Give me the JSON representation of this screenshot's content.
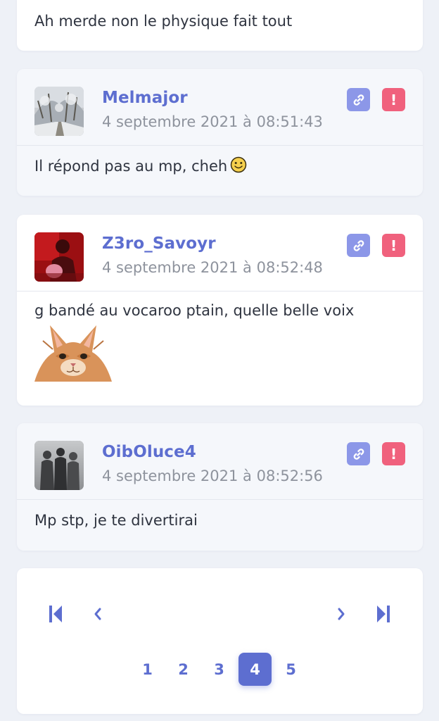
{
  "colors": {
    "accent": "#5d6ed0",
    "link_button": "#8c97e8",
    "report_button": "#f0617d",
    "date_text": "#8e939d"
  },
  "posts": [
    {
      "body": "Ah merde non le physique fait tout"
    },
    {
      "author": "Melmajor",
      "date": "4 septembre 2021 à 08:51:43",
      "body": "Il répond pas au mp, cheh",
      "emoji": "smiley-icon"
    },
    {
      "author": "Z3ro_Savoyr",
      "date": "4 septembre 2021 à 08:52:48",
      "body": "g bandé au vocaroo ptain, quelle belle voix",
      "image": "cat-sticker"
    },
    {
      "author": "OibOluce4",
      "date": "4 septembre 2021 à 08:52:56",
      "body": "Mp stp, je te divertirai"
    }
  ],
  "actions": {
    "link_icon": "link-icon",
    "report_icon": "exclamation-icon",
    "report_glyph": "!"
  },
  "pagination": {
    "pages": [
      "1",
      "2",
      "3",
      "4",
      "5"
    ],
    "current": "4",
    "icons": [
      "first-page-icon",
      "previous-page-icon",
      "next-page-icon",
      "last-page-icon"
    ]
  }
}
